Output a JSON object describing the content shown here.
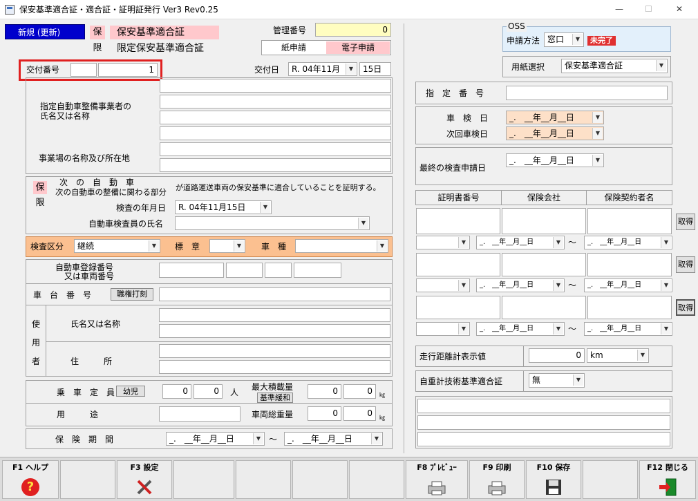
{
  "window": {
    "title": "保安基準適合証・適合証・証明証発行 Ver3 Rev0.25",
    "controls": [
      "—",
      "☐",
      "✕"
    ]
  },
  "header": {
    "new_button": "新規 (更新)",
    "ho_mark": "保",
    "gen_mark": "限",
    "doc_type_1": "保安基準適合証",
    "doc_type_2": "限定保安基準適合証",
    "kanri_label": "管理番号",
    "kanri_value": "0",
    "paper_tab": "紙申請",
    "electronic_tab": "電子申請"
  },
  "koufu": {
    "label": "交付番号",
    "prefix": "",
    "value": "1",
    "date_label": "交付日",
    "era": "R. 04年11月",
    "day": "15日"
  },
  "jigyosha": {
    "label1": "指定自動車整備事業者の",
    "label2": "氏名又は名称",
    "label3": "事業場の名称及び所在地"
  },
  "cert": {
    "ho": "保",
    "gen": "限",
    "text1": "次　の　自　動　車",
    "text2": "次の自動車の整備に関わる部分",
    "text3": "が道路運送車両の保安基準に適合していることを証明する。",
    "date_label": "検査の年月日",
    "date_value": "R. 04年11月15日",
    "inspector_label": "自動車検査員の氏名",
    "inspector_value": ""
  },
  "kensa": {
    "label": "検査区分",
    "value": "継続",
    "hyosho_label": "標　章",
    "hyosho_value": "",
    "shashu_label": "車　種",
    "shashu_value": ""
  },
  "vehicle": {
    "reg_label1": "自動車登録番号",
    "reg_label2": "又は車両番号",
    "chassis_label": "車　台　番　号",
    "chassis_button": "職権打刻",
    "user_label": "使用者",
    "user_l1": "使",
    "user_l2": "用",
    "user_l3": "者",
    "name_label": "氏名又は名称",
    "address_label": "住　　　所"
  },
  "capacity": {
    "label": "乗　車　定　員",
    "kid_button": "幼児",
    "adult": "0",
    "child": "0",
    "unit_person": "人",
    "load_label": "最大積載量",
    "relax_button": "基準緩和",
    "load1": "0",
    "load2": "0",
    "unit_kg": "㎏",
    "purpose_label": "用　　　途",
    "gross_label": "車両総重量",
    "gross1": "0",
    "gross2": "0"
  },
  "insurance_period": {
    "label": "保　険　期　間",
    "start": "_.　__年__月__日",
    "tilde": "〜",
    "end": "_.　__年__月__日"
  },
  "oss": {
    "legend": "OSS",
    "method_label": "申請方法",
    "method_value": "窓口",
    "status": "未完了",
    "paper_label": "用紙選択",
    "paper_value": "保安基準適合証"
  },
  "right": {
    "shitei_label": "指　定　番　号",
    "shaken_label": "車　検　日",
    "shaken_value": "_.　__年__月__日",
    "next_label": "次回車検日",
    "next_value": "_.　__年__月__日",
    "last_label": "最終の検査申請日",
    "last_value": "_.　__年__月__日",
    "col1": "証明書番号",
    "col2": "保険会社",
    "col3": "保険契約者名",
    "get_button": "取得",
    "date_small": "_.　__年__月__日",
    "tilde": "〜",
    "odo_label": "走行距離計表示値",
    "odo_value": "0",
    "odo_unit": "km",
    "tech_label": "自重計技術基準適合証",
    "tech_value": "無"
  },
  "fkeys": {
    "f1": "F1 ヘルプ",
    "f3": "F3 設定",
    "f8": "F8 ﾌﾟﾚﾋﾞｭｰ",
    "f9": "F9 印刷",
    "f10": "F10 保存",
    "f12": "F12 閉じる"
  },
  "colors": {
    "accent_blue": "#0000cc",
    "pink": "#ffc8cc",
    "yellow": "#fffdc0",
    "orange": "#fde0c8",
    "status_red": "#e03030",
    "oss_blue": "#e3f0fb",
    "highlight": "#e02020"
  }
}
